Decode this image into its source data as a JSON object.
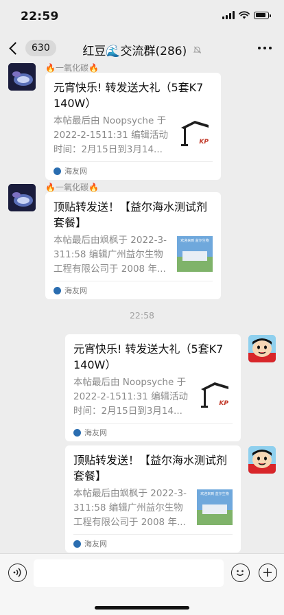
{
  "status": {
    "time": "22:59"
  },
  "header": {
    "back_count": "630",
    "title": "红豆🌊交流群(286)"
  },
  "messages": [
    {
      "side": "left",
      "sender": "🔥一氧化碳🔥",
      "card": {
        "title": "元宵快乐! 转发送大礼（5套K7 140W）",
        "desc": "本帖最后由 Noopsyche 于 2022-2-1511:31 编辑活动时间：2月15日到3月14...",
        "source": "海友网",
        "thumb_text": "KP"
      }
    },
    {
      "side": "left",
      "sender": "🔥一氧化碳🔥",
      "card": {
        "title": "顶贴转发送！【益尔海水测试剂套餐】",
        "desc": "本帖最后由飒枫于 2022-3-311:58 编辑广州益尔生物工程有限公司于 2008 年...",
        "source": "海友网",
        "thumb_text": "欢迎来到 益尔生物"
      }
    },
    {
      "side": "right",
      "card": {
        "title": "元宵快乐! 转发送大礼（5套K7 140W）",
        "desc": "本帖最后由 Noopsyche 于 2022-2-1511:31 编辑活动时间：2月15日到3月14...",
        "source": "海友网",
        "thumb_text": "KP"
      }
    },
    {
      "side": "right",
      "card": {
        "title": "顶贴转发送！【益尔海水测试剂套餐】",
        "desc": "本帖最后由飒枫于 2022-3-311:58 编辑广州益尔生物工程有限公司于 2008 年...",
        "source": "海友网",
        "thumb_text": "欢迎来到 益尔生物"
      }
    }
  ],
  "time_separator": "22:58",
  "input": {
    "value": ""
  },
  "colors": {
    "background": "#ededed",
    "card": "#ffffff",
    "gray_text": "#8a8a8a"
  }
}
